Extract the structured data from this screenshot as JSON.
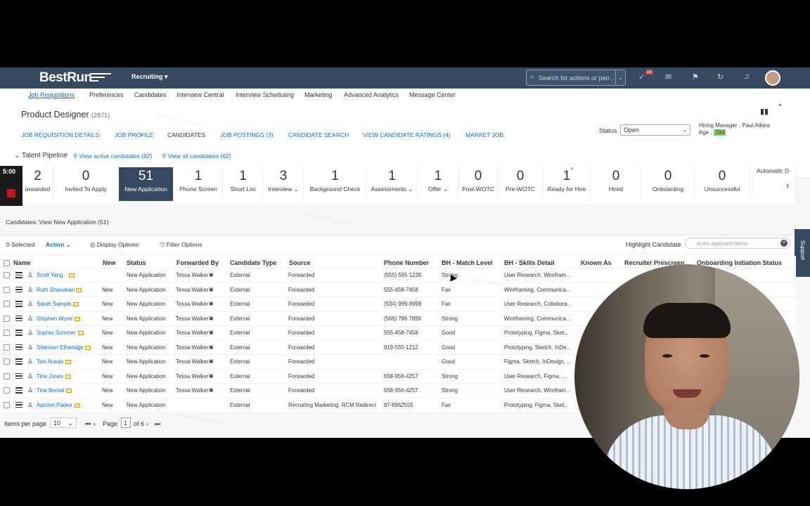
{
  "shell": {
    "brand_best": "Best",
    "brand_run": "Run",
    "menu": "Recruiting ▾",
    "search_placeholder": "Search for actions or peo...",
    "notif_count": "10"
  },
  "nav": [
    "Job Requisitions",
    "Preferences",
    "Candidates",
    "Interview Central",
    "Interview Scheduling",
    "Marketing",
    "Advanced Analytics",
    "Message Center"
  ],
  "header": {
    "title": "Product Designer",
    "title_count": "(2871)",
    "tabs": [
      "JOB REQUISITION DETAILS",
      "JOB PROFILE",
      "CANDIDATES",
      "JOB POSTINGS (3)",
      "CANDIDATE SEARCH",
      "VIEW CANDIDATE RATINGS (4)",
      "MARKET JOB"
    ],
    "status_label": "Status",
    "status_value": "Open",
    "hiring_manager": "Hiring Manager : Paul Atkins",
    "age_label": "Age :",
    "age_value": "29d",
    "pipeline_label": "Talent Pipeline",
    "active_link": "View active candidates (62)",
    "all_link": "View all candidates (62)"
  },
  "timer": "5:00",
  "pipeline": [
    {
      "n": "2",
      "l": "orwarded"
    },
    {
      "n": "0",
      "l": "Invited To Apply"
    },
    {
      "n": "51",
      "l": "New Application",
      "active": true
    },
    {
      "n": "1",
      "l": "Phone Screen"
    },
    {
      "n": "1",
      "l": "Short List"
    },
    {
      "n": "3",
      "l": "Interview ⌄"
    },
    {
      "n": "1",
      "l": "Background Check"
    },
    {
      "n": "1",
      "l": "Assessments ⌄"
    },
    {
      "n": "1",
      "l": "Offer ⌄"
    },
    {
      "n": "0",
      "l": "Post-WOTC"
    },
    {
      "n": "0",
      "l": "Pre-WOTC"
    },
    {
      "n": "1",
      "l": "Ready for Hire",
      "star": true
    },
    {
      "n": "0",
      "l": "Hired"
    },
    {
      "n": "0",
      "l": "Onboarding"
    },
    {
      "n": "0",
      "l": "Unsuccessful"
    },
    {
      "n": "",
      "l": "Automatic D"
    }
  ],
  "view_line": "Candidates:  View New Application (51)",
  "toolbar": {
    "selected": "0 Selected",
    "action": "Action ⌄",
    "display": "Display Options",
    "filter": "Filter Options",
    "highlight": "Highlight Candidate",
    "highlight_placeholder": "Enter Applicant Name",
    "support": "Support"
  },
  "columns": [
    "Name",
    "New",
    "Status",
    "Forwarded By",
    "Candidate Type",
    "Source",
    "Phone Number",
    "BH - Match Level",
    "BH - Skills Detail",
    "Known As",
    "Recruiter Prescreen",
    "Onboarding Initiation Status"
  ],
  "rows": [
    {
      "name": "Scott Yang",
      "new": "",
      "status": "New Application",
      "fwd": "Tessa Walker",
      "type": "External",
      "source": "Forwarded",
      "phone": "(555) 555-1235",
      "match": "Strong",
      "skills": "User Research, Wirefram..."
    },
    {
      "name": "Ruth Shanahan",
      "new": "New",
      "status": "New Application",
      "fwd": "Tessa Walker",
      "type": "External",
      "source": "Forwarded",
      "phone": "555-458-7458",
      "match": "Fair",
      "skills": "Wireframing, Communica..."
    },
    {
      "name": "Sarah Sample",
      "new": "New",
      "status": "New Application",
      "fwd": "Tessa Walker",
      "type": "External",
      "source": "Forwarded",
      "phone": "(534) 999-9999",
      "match": "Fair",
      "skills": "User Research, Collabora..."
    },
    {
      "name": "Stephen Wyne",
      "new": "New",
      "status": "New Application",
      "fwd": "Tessa Walker",
      "type": "External",
      "source": "Forwarded",
      "phone": "(566) 786 7899",
      "match": "Strong",
      "skills": "Wireframing, Communica..."
    },
    {
      "name": "Sophia Summer",
      "new": "New",
      "status": "New Application",
      "fwd": "Tessa Walker",
      "type": "External",
      "source": "Forwarded",
      "phone": "555-458-7458",
      "match": "Good",
      "skills": "Prototyping, Figma, Sket..."
    },
    {
      "name": "Shannon Etheridge",
      "new": "New",
      "status": "New Application",
      "fwd": "Tessa Walker",
      "type": "External",
      "source": "Forwarded",
      "phone": "919-555-1212",
      "match": "Good",
      "skills": "Prototyping, Sketch, InDe..."
    },
    {
      "name": "Tais Araujo",
      "new": "New",
      "status": "New Application",
      "fwd": "Tessa Walker",
      "type": "External",
      "source": "Forwarded",
      "phone": "",
      "match": "Good",
      "skills": "Figma, Sketch, InDesign, ..."
    },
    {
      "name": "Tina Jones",
      "new": "New",
      "status": "New Application",
      "fwd": "Tessa Walker",
      "type": "External",
      "source": "Forwarded",
      "phone": "658-956-4257",
      "match": "Strong",
      "skills": "User Research, Figma, ..."
    },
    {
      "name": "Tina Bernal",
      "new": "New",
      "status": "New Application",
      "fwd": "Tessa Walker",
      "type": "External",
      "source": "Forwarded",
      "phone": "658-956-4257",
      "match": "Strong",
      "skills": "User Research, Wirefram..."
    },
    {
      "name": "Apichet Padee",
      "new": "New",
      "status": "New Application",
      "fwd": "",
      "type": "External",
      "source": "Recruiting Marketing: RCM Redirect",
      "phone": "87-6962555",
      "match": "Fair",
      "skills": "Prototyping, Figma, Sket..."
    }
  ],
  "pager": {
    "items_label": "Items per page",
    "items_value": "10",
    "page_label": "Page",
    "page_value": "1",
    "of": "of 6"
  },
  "watermark": "Design In Progress"
}
